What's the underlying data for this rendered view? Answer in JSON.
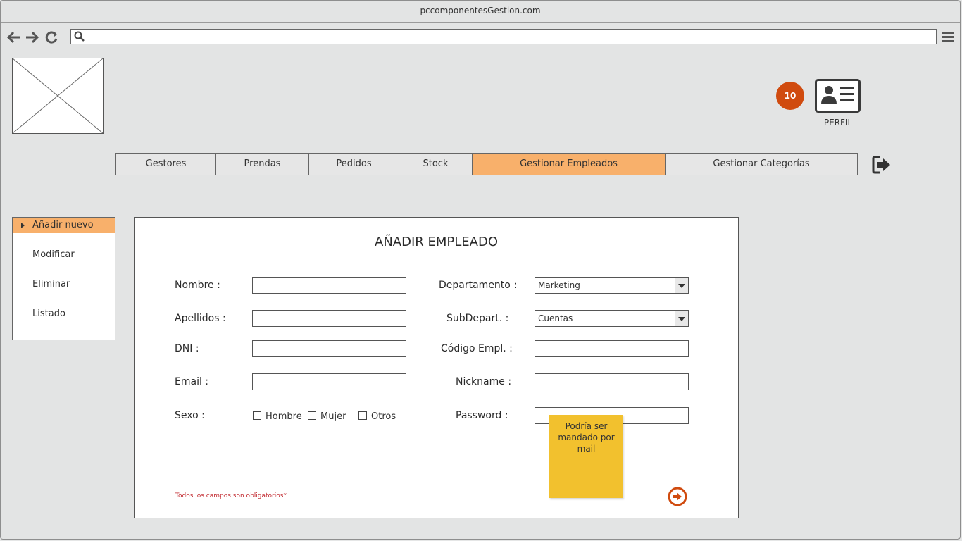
{
  "window": {
    "title": "pccomponentesGestion.com"
  },
  "header": {
    "notification_count": "10",
    "profile_label": "PERFIL"
  },
  "tabs": [
    {
      "label": "Gestores"
    },
    {
      "label": "Prendas"
    },
    {
      "label": "Pedidos"
    },
    {
      "label": "Stock"
    },
    {
      "label": "Gestionar Empleados",
      "active": true
    },
    {
      "label": "Gestionar Categorías"
    }
  ],
  "sidebar": {
    "items": [
      {
        "label": "Añadir nuevo",
        "active": true
      },
      {
        "label": "Modificar"
      },
      {
        "label": "Eliminar"
      },
      {
        "label": "Listado"
      }
    ]
  },
  "form": {
    "title": "AÑADIR EMPLEADO",
    "left_fields": [
      {
        "label": "Nombre :",
        "value": ""
      },
      {
        "label": "Apellidos :",
        "value": ""
      },
      {
        "label": "DNI :",
        "value": ""
      },
      {
        "label": "Email :",
        "value": ""
      }
    ],
    "sexo": {
      "label": "Sexo :",
      "options": [
        "Hombre",
        "Mujer",
        "Otros"
      ]
    },
    "right_fields": {
      "departamento": {
        "label": "Departamento :",
        "value": "Marketing"
      },
      "subdepart": {
        "label": "SubDepart. :",
        "value": "Cuentas"
      },
      "codigo": {
        "label": "Código Empl. :",
        "value": ""
      },
      "nickname": {
        "label": "Nickname :",
        "value": ""
      },
      "password": {
        "label": "Password :",
        "value": ""
      }
    },
    "required_note": "Todos los campos son obligatorios*",
    "sticky_note": "Podría ser mandado por mail"
  },
  "colors": {
    "accent": "#f8b06b",
    "badge": "#d04b0f",
    "sticky": "#f2c12e",
    "required": "#c1272d"
  },
  "icons": [
    "back-arrow-icon",
    "forward-arrow-icon",
    "reload-icon",
    "search-icon",
    "hamburger-menu-icon",
    "profile-card-icon",
    "logout-icon",
    "submit-arrow-icon"
  ]
}
